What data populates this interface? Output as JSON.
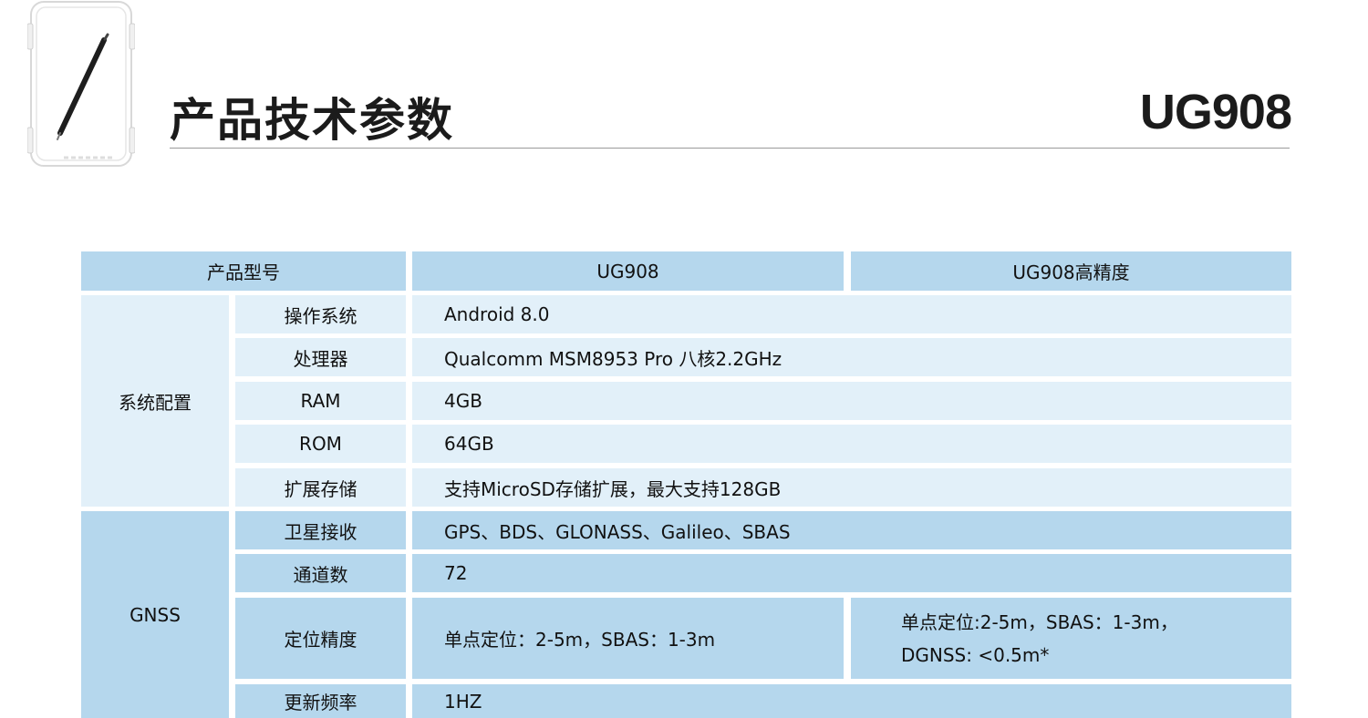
{
  "header": {
    "title": "产品技术参数",
    "model": "UG908"
  },
  "table": {
    "header": {
      "label": "产品型号",
      "col1": "UG908",
      "col2": "UG908高精度"
    },
    "groups": [
      {
        "name": "系统配置",
        "rows": [
          {
            "label": "操作系统",
            "value": "Android 8.0"
          },
          {
            "label": "处理器",
            "value": "Qualcomm MSM8953 Pro  八核2.2GHz"
          },
          {
            "label": "RAM",
            "value": "4GB"
          },
          {
            "label": "ROM",
            "value": "64GB"
          },
          {
            "label": "扩展存储",
            "value": "支持MicroSD存储扩展，最大支持128GB"
          }
        ]
      },
      {
        "name": "GNSS",
        "rows": [
          {
            "label": "卫星接收",
            "value": "GPS、BDS、GLONASS、Galileo、SBAS"
          },
          {
            "label": "通道数",
            "value": "72"
          },
          {
            "label": "定位精度",
            "value": "单点定位：2-5m，SBAS：1-3m",
            "value2_line1": "单点定位:2-5m，SBAS：1-3m，",
            "value2_line2": "DGNSS: <0.5m*"
          },
          {
            "label": "更新频率",
            "value": "1HZ"
          }
        ]
      }
    ]
  },
  "colors": {
    "header_cell": "#b5d7ed",
    "light_cell": "#e2f0f9",
    "rule": "#9a9a9a"
  }
}
